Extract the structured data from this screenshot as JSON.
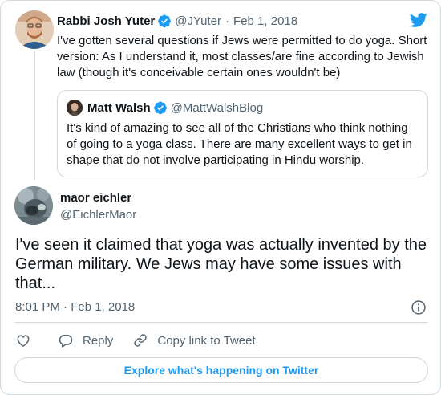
{
  "parent": {
    "name": "Rabbi Josh Yuter",
    "handle": "@JYuter",
    "separator": "·",
    "date": "Feb 1, 2018",
    "text": "I've gotten several questions if Jews were permitted to do yoga. Short version: As I understand it, most classes/are fine according to Jewish law (though it's conceivable certain ones wouldn't be)"
  },
  "quote": {
    "name": "Matt Walsh",
    "handle": "@MattWalshBlog",
    "text": "It's kind of amazing to see all of the Christians who think nothing of going to a yoga class. There are many excellent ways to get in shape that do not involve participating in Hindu worship."
  },
  "main": {
    "name": "maor eichler",
    "handle": "@EichlerMaor",
    "text": "I've seen it claimed that yoga was actually invented by the German military. We Jews may have some issues with that...",
    "timestamp": "8:01 PM · Feb 1, 2018"
  },
  "actions": {
    "reply_label": "Reply",
    "copy_link_label": "Copy link to Tweet"
  },
  "explore_label": "Explore what's happening on Twitter",
  "icons": {
    "brand": "twitter-bird-icon",
    "verified": "verified-badge-icon",
    "info": "info-icon",
    "like": "heart-icon",
    "reply": "reply-bubble-icon",
    "copy": "link-icon"
  },
  "colors": {
    "twitter_blue": "#1d9bf0",
    "text": "#0f1419",
    "muted": "#536471",
    "border": "#cfd9de"
  }
}
